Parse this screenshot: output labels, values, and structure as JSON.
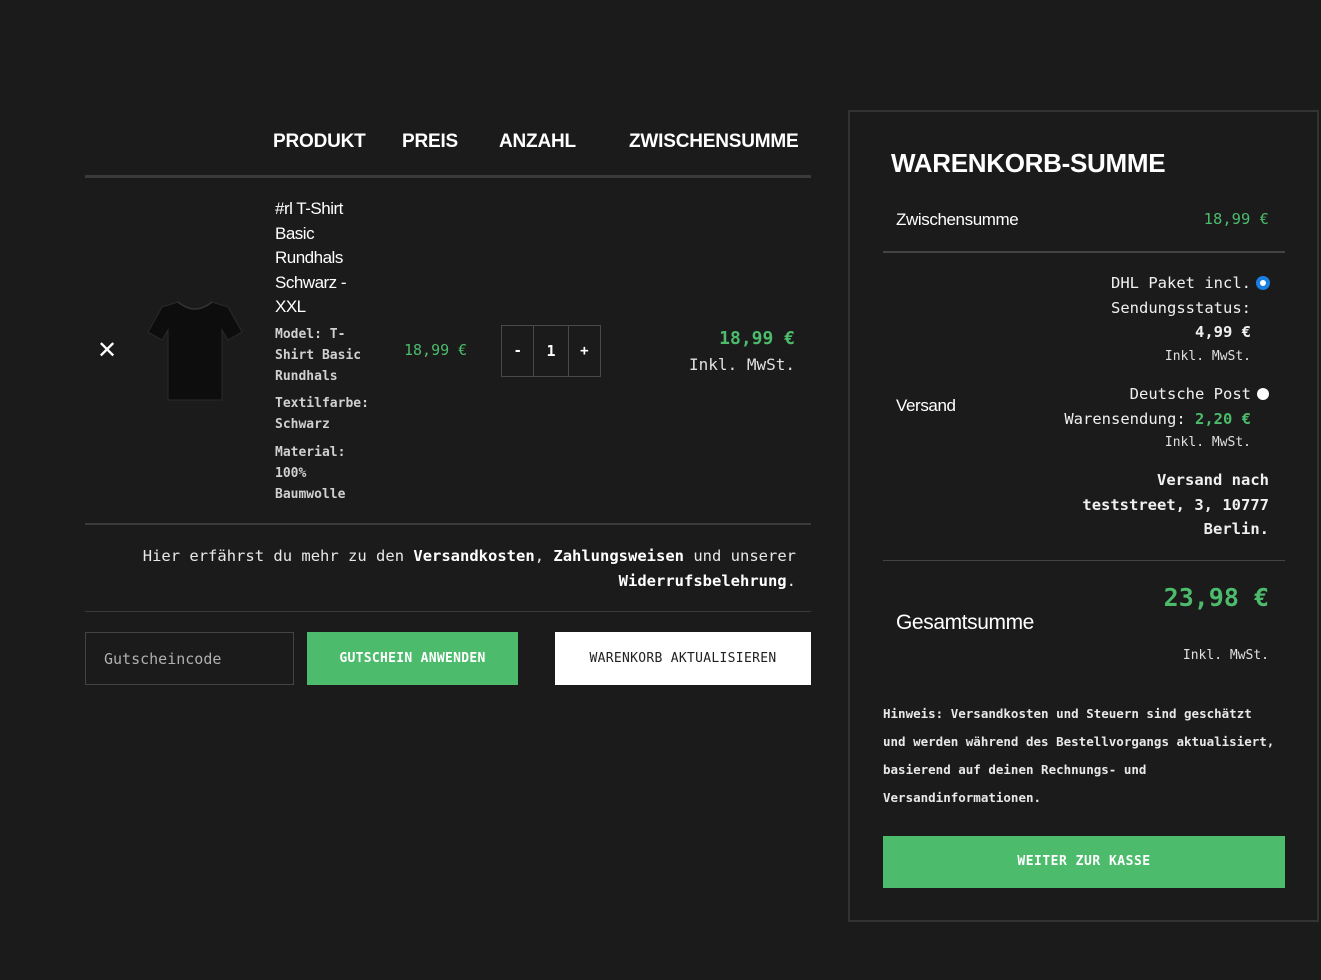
{
  "cart": {
    "headers": {
      "product": "PRODUKT",
      "price": "PREIS",
      "quantity": "ANZAHL",
      "subtotal": "ZWISCHENSUMME"
    },
    "item": {
      "remove_symbol": "✕",
      "name_lines": [
        "#rl T-Shirt",
        "Basic",
        "Rundhals",
        "Schwarz -",
        "XXL"
      ],
      "meta": [
        [
          "Model: T-",
          "Shirt Basic",
          "Rundhals"
        ],
        [
          "Textilfarbe:",
          "Schwarz"
        ],
        [
          "Material:",
          "100%",
          "Baumwolle"
        ]
      ],
      "image_icon": "tshirt-image",
      "price": "18,99 €",
      "qty_minus": "-",
      "qty_value": "1",
      "qty_plus": "+",
      "subtotal": "18,99 €",
      "subtotal_tax": "Inkl. MwSt."
    },
    "info": {
      "text_1": "Hier erfährst du mehr zu den ",
      "link_shipping": "Versandkosten",
      "text_2": ", ",
      "link_payment": "Zahlungsweisen",
      "text_3": " und unserer ",
      "link_revocation": "Widerrufsbelehrung",
      "text_4": "."
    },
    "coupon_placeholder": "Gutscheincode",
    "apply_coupon_label": "GUTSCHEIN ANWENDEN",
    "update_cart_label": "WARENKORB AKTUALISIEREN"
  },
  "totals": {
    "title": "WARENKORB-SUMME",
    "subtotal_label": "Zwischensumme",
    "subtotal_value": "18,99 €",
    "shipping_label": "Versand",
    "shipping_options": [
      {
        "line1": "DHL Paket incl.",
        "line2": "Sendungsstatus:",
        "price": "4,99 €",
        "tax": "Inkl. MwSt.",
        "selected": true
      },
      {
        "line1": "Deutsche Post",
        "line2": "Warensendung: ",
        "price": "2,20 €",
        "tax": "Inkl. MwSt.",
        "selected": false
      }
    ],
    "ship_to": [
      "Versand nach",
      "teststreet, 3, 10777",
      "Berlin."
    ],
    "total_label": "Gesamtsumme",
    "total_value": "23,98 €",
    "total_tax": "Inkl. MwSt.",
    "note_lines": [
      "Hinweis: Versandkosten und Steuern sind geschätzt",
      "und werden während des Bestellvorgangs aktualisiert,",
      "basierend auf deinen Rechnungs- und",
      "Versandinformationen."
    ],
    "checkout_label": "WEITER ZUR KASSE"
  },
  "colors": {
    "background": "#1b1b1b",
    "accent_green": "#4cbb6c",
    "radio_blue": "#1a7fe0"
  }
}
